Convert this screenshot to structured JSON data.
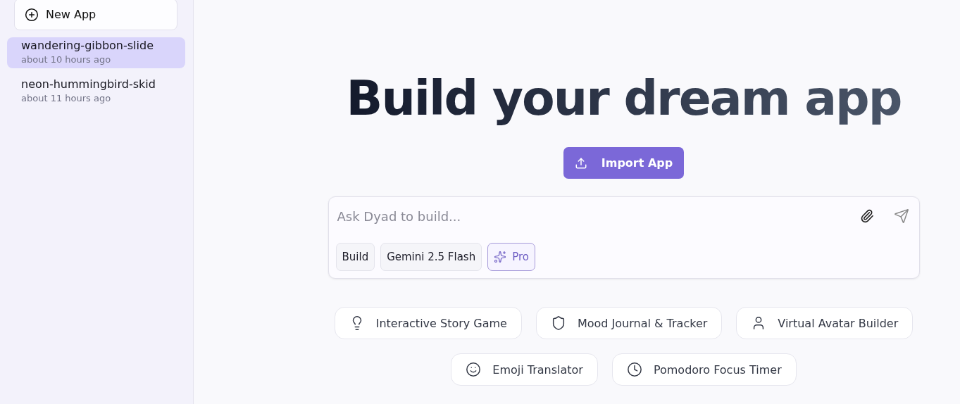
{
  "sidebar": {
    "new_app_button": "New App",
    "apps": [
      {
        "name": "wandering-gibbon-slide",
        "time": "about 10 hours ago",
        "selected": true
      },
      {
        "name": "neon-hummingbird-skid",
        "time": "about 11 hours ago",
        "selected": false
      }
    ]
  },
  "main": {
    "title": "Build your dream app",
    "import_button": "Import App",
    "prompt": {
      "placeholder": "Ask Dyad to build...",
      "chips": [
        {
          "label": "Build",
          "kind": "plain"
        },
        {
          "label": "Gemini 2.5 Flash",
          "kind": "plain"
        },
        {
          "label": "Pro",
          "kind": "pro"
        }
      ]
    },
    "suggestions": [
      {
        "label": "Interactive Story Game"
      },
      {
        "label": "Mood Journal & Tracker"
      },
      {
        "label": "Virtual Avatar Builder"
      },
      {
        "label": "Emoji Translator"
      },
      {
        "label": "Pomodoro Focus Timer"
      }
    ]
  }
}
